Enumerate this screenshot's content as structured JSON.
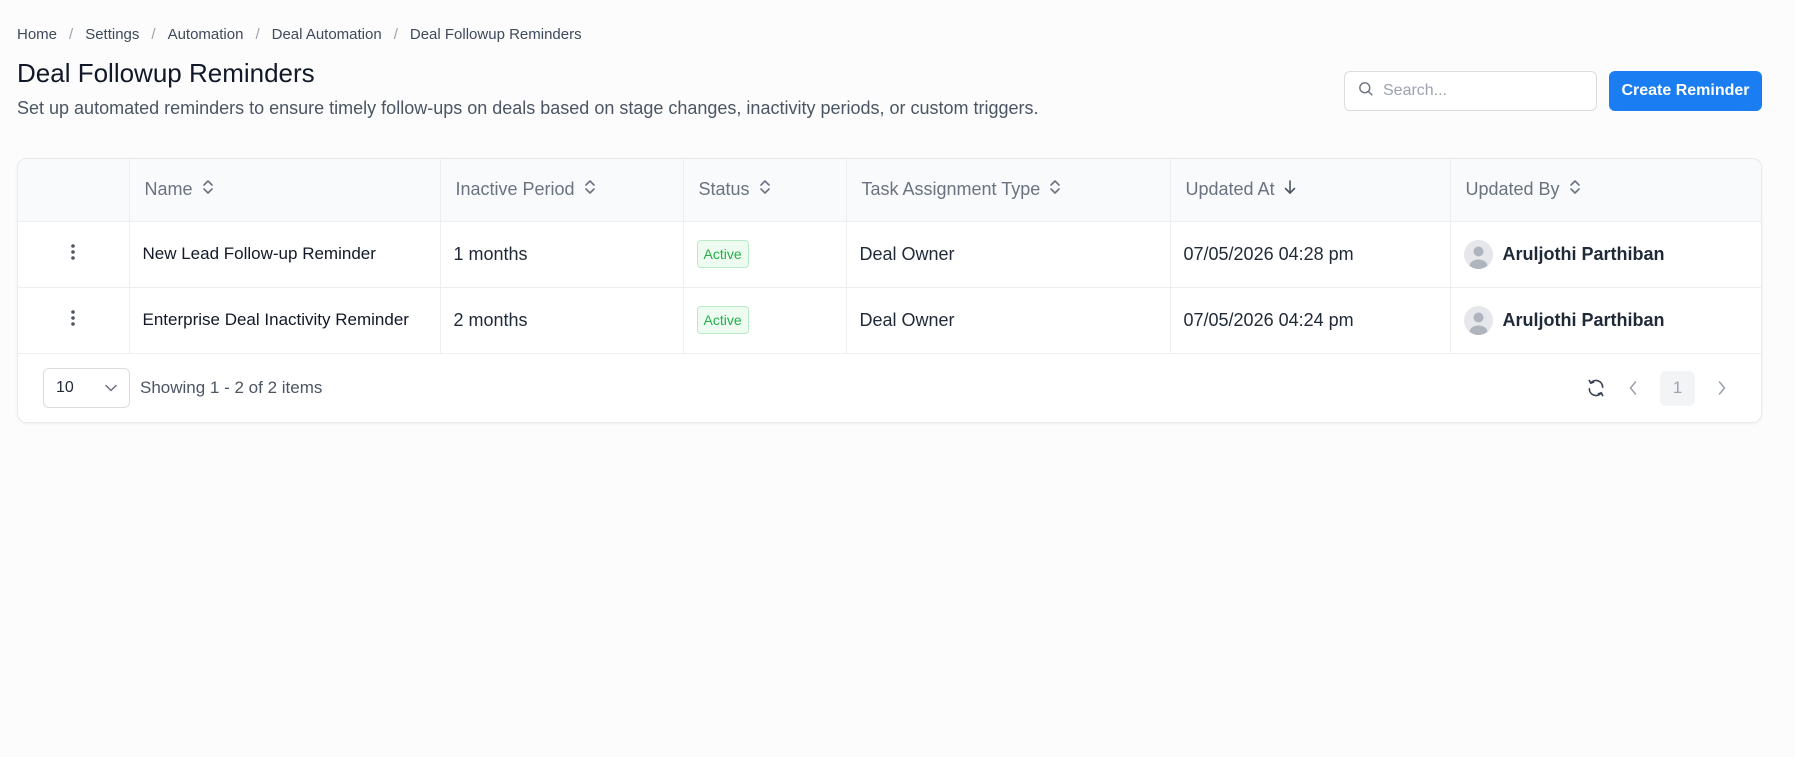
{
  "breadcrumb": {
    "items": [
      "Home",
      "Settings",
      "Automation",
      "Deal Automation",
      "Deal Followup Reminders"
    ],
    "separator": "/"
  },
  "page": {
    "title": "Deal Followup Reminders",
    "description": "Set up automated reminders to ensure timely follow-ups on deals based on stage changes, inactivity periods, or custom triggers."
  },
  "search": {
    "placeholder": "Search...",
    "value": ""
  },
  "actions": {
    "create_label": "Create Reminder"
  },
  "table": {
    "columns": [
      {
        "label": "Name",
        "sort": "sortable"
      },
      {
        "label": "Inactive Period",
        "sort": "sortable"
      },
      {
        "label": "Status",
        "sort": "sortable"
      },
      {
        "label": "Task Assignment Type",
        "sort": "sortable"
      },
      {
        "label": "Updated At",
        "sort": "descending"
      },
      {
        "label": "Updated By",
        "sort": "sortable"
      }
    ],
    "rows": [
      {
        "name": "New Lead Follow-up Reminder",
        "inactive_period": "1 months",
        "status": "Active",
        "task_assignment_type": "Deal Owner",
        "updated_at": "07/05/2026 04:28 pm",
        "updated_by": "Aruljothi Parthiban"
      },
      {
        "name": "Enterprise Deal Inactivity Reminder",
        "inactive_period": "2 months",
        "status": "Active",
        "task_assignment_type": "Deal Owner",
        "updated_at": "07/05/2026 04:24 pm",
        "updated_by": "Aruljothi Parthiban"
      }
    ]
  },
  "footer": {
    "page_size": "10",
    "showing": "Showing 1 - 2 of 2 items",
    "current_page": "1"
  },
  "colors": {
    "primary": "#1a7ef2",
    "status_active_text": "#22b04b",
    "status_active_bg": "#eefbf1"
  },
  "icons": [
    "search-icon",
    "sort-icon",
    "sort-desc-icon",
    "kebab-icon",
    "avatar-icon",
    "chevron-down-icon",
    "refresh-icon",
    "chevron-left-icon",
    "chevron-right-icon"
  ]
}
